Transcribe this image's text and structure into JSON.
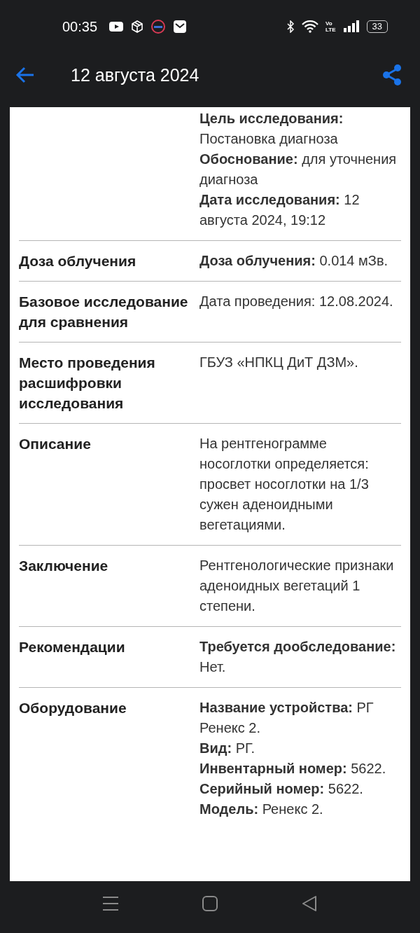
{
  "status_bar": {
    "time": "00:35",
    "volte": [
      "Vo",
      "LTE"
    ],
    "battery": "33"
  },
  "app_bar": {
    "title": "12 августа 2024"
  },
  "rows": [
    {
      "label": "",
      "items": [
        "**Цель исследования:** Постановка диагноза",
        "**Обоснование:** для уточнения диагноза",
        "**Дата исследования:** 12 августа 2024, 19:12"
      ]
    },
    {
      "label": "Доза облучения",
      "items": [
        "**Доза облучения:** 0.014 мЗв."
      ]
    },
    {
      "label": "Базовое исследование для сравнения",
      "items": [
        "Дата проведения: 12.08.2024."
      ]
    },
    {
      "label": "Место проведения расшифровки исследования",
      "items": [
        "ГБУЗ «НПКЦ ДиТ ДЗМ»."
      ]
    },
    {
      "label": "Описание",
      "items": [
        "На рентгенограмме носоглотки определяется: просвет носоглотки на 1/3 сужен аденоидными вегетациями."
      ]
    },
    {
      "label": "Заключение",
      "items": [
        "Рентгенологические признаки аденоидных вегетаций 1 степени."
      ]
    },
    {
      "label": "Рекомендации",
      "items": [
        "**Требуется дообследование:** Нет."
      ]
    },
    {
      "label": "Оборудование",
      "items": [
        "**Название устройства:** РГ Ренекс 2.",
        "**Вид:** РГ.",
        "**Инвентарный номер:** 5622.",
        "**Серийный номер:** 5622.",
        "**Модель:** Ренекс 2."
      ]
    }
  ]
}
